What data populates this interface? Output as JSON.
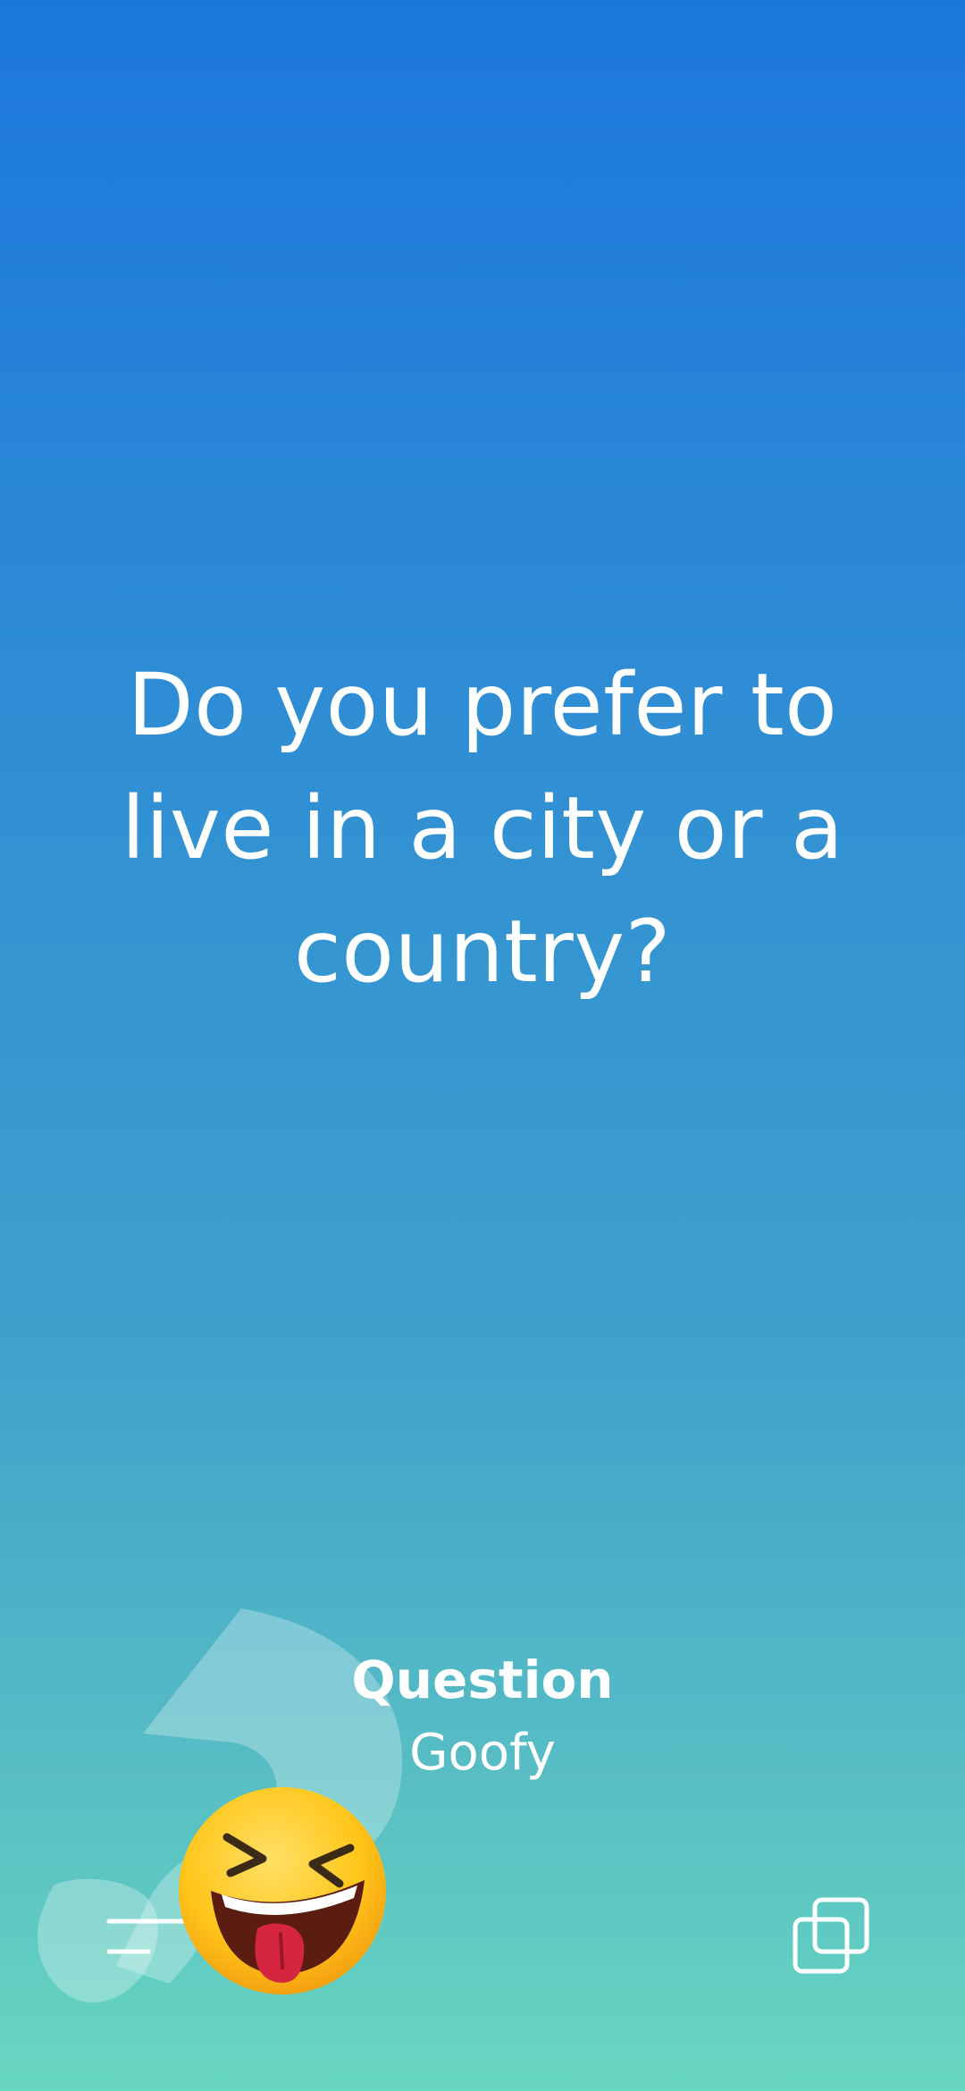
{
  "question": {
    "text": "Do you prefer to live in a city or a country?"
  },
  "meta": {
    "category": "Question",
    "deck": "Goofy"
  },
  "icons": {
    "menu": "menu-icon",
    "cards": "stacked-cards-icon",
    "emoji": "squinting-face-with-tongue-emoji",
    "decoration": "question-mark-shape"
  },
  "colors": {
    "gradient_top": "#1c77dc",
    "gradient_bottom": "#68d7bf",
    "text": "#ffffff",
    "emoji_yellow": "#ffc61a"
  }
}
